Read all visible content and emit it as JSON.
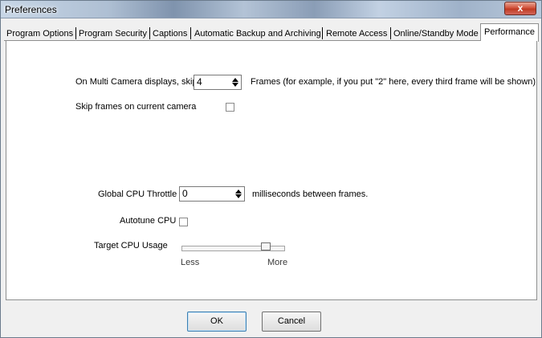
{
  "window": {
    "title": "Preferences",
    "close_glyph": "x"
  },
  "tabs": [
    {
      "label": "Program Options"
    },
    {
      "label": "Program Security"
    },
    {
      "label": "Captions"
    },
    {
      "label": "Automatic Backup and Archiving"
    },
    {
      "label": "Remote Access"
    },
    {
      "label": "Online/Standby Mode"
    },
    {
      "label": "Performance",
      "active": true
    }
  ],
  "performance": {
    "multi_camera_label": "On Multi Camera displays, skip",
    "multi_camera_value": "4",
    "multi_camera_suffix": "Frames (for example, if you put \"2\" here, every third frame will be shown)",
    "skip_current_label": "Skip frames on current camera",
    "skip_current_checked": false,
    "throttle_label": "Global CPU Throttle",
    "throttle_value": "0",
    "throttle_suffix": "milliseconds between frames.",
    "autotune_label": "Autotune CPU",
    "autotune_checked": false,
    "target_label": "Target CPU Usage",
    "target_min_label": "Less",
    "target_max_label": "More",
    "target_level": 0.85
  },
  "buttons": {
    "ok": "OK",
    "cancel": "Cancel"
  },
  "colors": {
    "close_button": "#c7422a",
    "tab_border": "#8e8f8f"
  }
}
